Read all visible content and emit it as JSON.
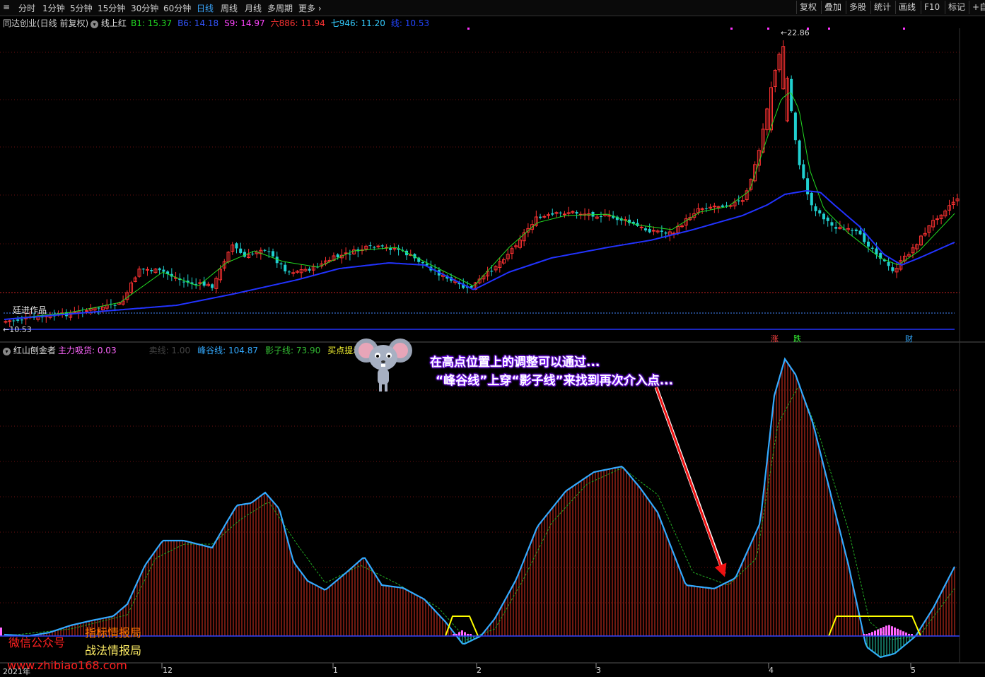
{
  "toolbar": {
    "periods": [
      "分时",
      "1分钟",
      "5分钟",
      "15分钟",
      "30分钟",
      "60分钟",
      "日线",
      "周线",
      "月线",
      "多周期",
      "更多"
    ],
    "active": "日线",
    "right_buttons": [
      "复权",
      "叠加",
      "多股",
      "统计",
      "画线",
      "F10",
      "标记",
      "+自"
    ]
  },
  "upper_legend": {
    "stock": "同达创业(日线 前复权)",
    "indicator": "线上红",
    "items": [
      {
        "label": "B1: 15.37",
        "color": "#22dd22"
      },
      {
        "label": "B6: 14.18",
        "color": "#3355ff"
      },
      {
        "label": "S9: 14.97",
        "color": "#ff44ff"
      },
      {
        "label": "六886: 11.94",
        "color": "#ff3333"
      },
      {
        "label": "七946: 11.20",
        "color": "#33ccff"
      },
      {
        "label": "线: 10.53",
        "color": "#2244ff"
      }
    ],
    "high_label": "22.86",
    "low_label": "10.53",
    "author": "廷进作品",
    "flags": [
      "涨",
      "跌",
      "财"
    ]
  },
  "lower_legend": {
    "name": "红山刨金者",
    "items": [
      {
        "label": "主力吸货: 0.03",
        "color": "#ff66ff"
      },
      {
        "label": "卖线: 1.00",
        "color": "#444444"
      },
      {
        "label": "峰谷线: 104.87",
        "color": "#33aaff"
      },
      {
        "label": "影子线: 73.90",
        "color": "#33bb33"
      },
      {
        "label": "买点提示: 0.00",
        "color": "#ffff33"
      }
    ]
  },
  "annotation": {
    "line1": "在高点位置上的调整可以通过...",
    "line2": "“峰谷线”上穿“影子线”来找到再次介入点..."
  },
  "watermarks": {
    "wechat": "微信公众号",
    "brand1": "指标情报局",
    "brand2": "战法情报局",
    "url": "www.zhibiao168.com"
  },
  "x_axis": {
    "year_label": "2021年",
    "month_labels": [
      "12",
      "1",
      "2",
      "3",
      "4",
      "5"
    ]
  },
  "colors": {
    "up": "#ff3232",
    "down": "#20d0d0",
    "ma_fast": "#22dd22",
    "ma_slow": "#2233ff",
    "peak_valley": "#33aaff",
    "shadow": "#22aa22",
    "buy_hint": "#ffff00",
    "accumulate": "#ff66ff"
  },
  "chart_data": {
    "type": "candlestick",
    "price_range": [
      10.53,
      22.86
    ],
    "price_anchors": [
      {
        "date": "start",
        "price": 10.53
      },
      {
        "date": "peak",
        "price": 22.86
      }
    ],
    "lower_indicator": {
      "peak_valley_last": 104.87,
      "shadow_last": 73.9,
      "accumulate_last": 0.03,
      "buy_hint_last": 0.0
    }
  }
}
